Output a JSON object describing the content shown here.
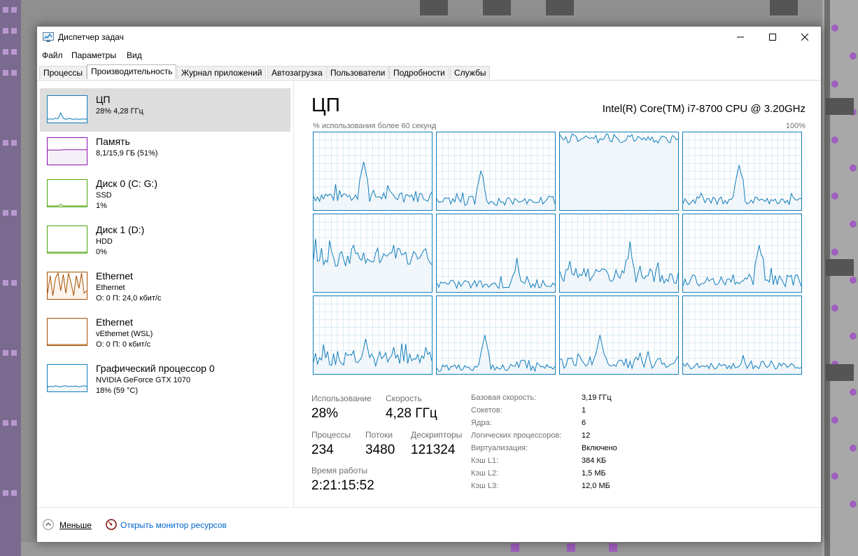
{
  "window": {
    "title": "Диспетчер задач"
  },
  "menu": [
    "Файл",
    "Параметры",
    "Вид"
  ],
  "tabs": [
    {
      "label": "Процессы",
      "active": false
    },
    {
      "label": "Производительность",
      "active": true
    },
    {
      "label": "Журнал приложений",
      "active": false
    },
    {
      "label": "Автозагрузка",
      "active": false
    },
    {
      "label": "Пользователи",
      "active": false
    },
    {
      "label": "Подробности",
      "active": false
    },
    {
      "label": "Службы",
      "active": false
    }
  ],
  "sidebar": [
    {
      "name": "ЦП",
      "line1": "28% 4,28 ГГц",
      "line2": "",
      "color": "#117dbb",
      "fill": "#f1f6fa"
    },
    {
      "name": "Память",
      "line1": "8,1/15,9 ГБ (51%)",
      "line2": "",
      "color": "#8b12ae",
      "fill": "#f5eff8"
    },
    {
      "name": "Диск 0 (C: G:)",
      "line1": "SSD",
      "line2": "1%",
      "color": "#4da60c",
      "fill": "#eff7ea"
    },
    {
      "name": "Диск 1 (D:)",
      "line1": "HDD",
      "line2": "0%",
      "color": "#4da60c",
      "fill": "#eff7ea"
    },
    {
      "name": "Ethernet",
      "line1": "Ethernet",
      "line2": "О: 0 П: 24,0 кбит/с",
      "color": "#a74f01",
      "fill": "#fcf3eb"
    },
    {
      "name": "Ethernet",
      "line1": "vEthernet (WSL)",
      "line2": "О: 0 П: 0 кбит/с",
      "color": "#a74f01",
      "fill": "#fcf3eb"
    },
    {
      "name": "Графический процессор 0",
      "line1": "NVIDIA GeForce GTX 1070",
      "line2": "18% (59 °C)",
      "color": "#117dbb",
      "fill": "#f1f6fa"
    }
  ],
  "main": {
    "title": "ЦП",
    "cpu_model": "Intel(R) Core(TM) i7-8700 CPU @ 3.20GHz",
    "graph_label": "% использования более 60 секунд",
    "graph_max": "100%"
  },
  "stats": {
    "usage_label": "Использование",
    "usage_value": "28%",
    "speed_label": "Скорость",
    "speed_value": "4,28 ГГц",
    "processes_label": "Процессы",
    "processes_value": "234",
    "threads_label": "Потоки",
    "threads_value": "3480",
    "handles_label": "Дескрипторы",
    "handles_value": "121324",
    "uptime_label": "Время работы",
    "uptime_value": "2:21:15:52"
  },
  "info": [
    {
      "label": "Базовая скорость:",
      "value": "3,19 ГГц"
    },
    {
      "label": "Сокетов:",
      "value": "1"
    },
    {
      "label": "Ядра:",
      "value": "6"
    },
    {
      "label": "Логических процессоров:",
      "value": "12"
    },
    {
      "label": "Виртуализация:",
      "value": "Включено"
    },
    {
      "label": "Кэш L1:",
      "value": "384 КБ"
    },
    {
      "label": "Кэш L2:",
      "value": "1,5 МБ"
    },
    {
      "label": "Кэш L3:",
      "value": "12,0 МБ"
    }
  ],
  "bottom": {
    "fewer_label": "Меньше",
    "resmon_label": "Открыть монитор ресурсов"
  },
  "colors": {
    "cpu_line": "#117dbb",
    "cpu_fill": "#f1f6fa",
    "grid_line": "#d9eaf4"
  }
}
